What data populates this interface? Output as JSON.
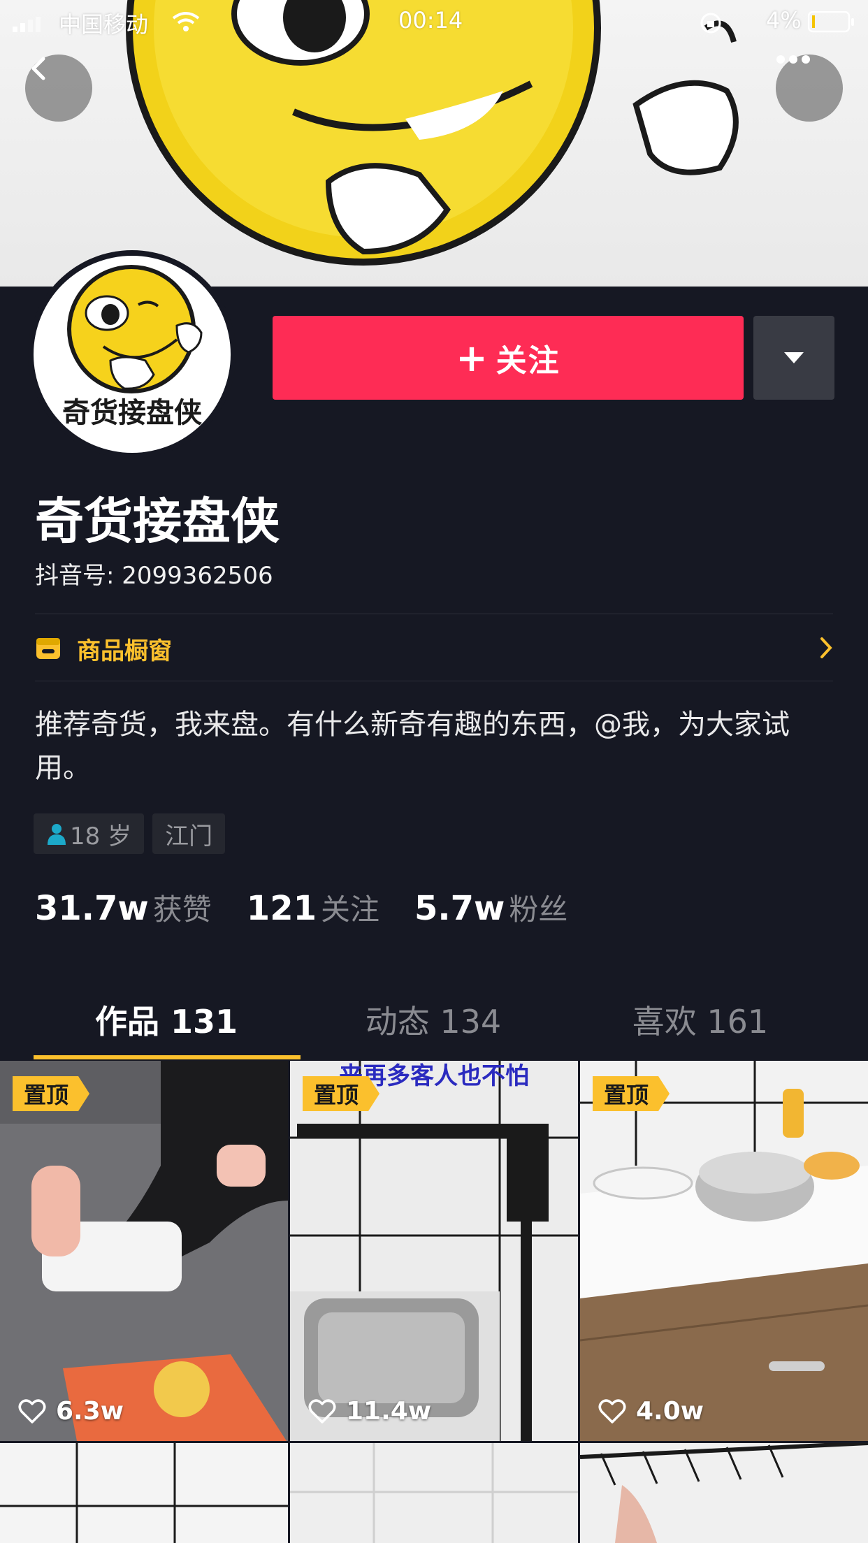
{
  "status_bar": {
    "carrier": "中国移动",
    "time": "00:14",
    "battery": "4%"
  },
  "profile": {
    "avatar_text": "奇货接盘侠",
    "name": "奇货接盘侠",
    "uid": "抖音号: 2099362506",
    "follow_label": "关注",
    "shop_label": "商品橱窗",
    "bio": "推荐奇货，我来盘。有什么新奇有趣的东西，@我，为大家试用。",
    "tags": [
      "18 岁",
      "江门"
    ],
    "stats": [
      {
        "num": "31.7w",
        "label": "获赞"
      },
      {
        "num": "121",
        "label": "关注"
      },
      {
        "num": "5.7w",
        "label": "粉丝"
      }
    ]
  },
  "tabs": [
    {
      "label": "作品 131",
      "active": true
    },
    {
      "label": "动态 134",
      "active": false
    },
    {
      "label": "喜欢 161",
      "active": false
    }
  ],
  "videos": [
    {
      "pinned": "置顶",
      "likes": "6.3w",
      "caption": ""
    },
    {
      "pinned": "置顶",
      "likes": "11.4w",
      "caption": "来再多客人也不怕"
    },
    {
      "pinned": "置顶",
      "likes": "4.0w",
      "caption": ""
    }
  ],
  "colors": {
    "background": "#161823",
    "follow": "#fe2c55",
    "accent": "#fbc02d"
  },
  "icons": [
    "back-icon",
    "more-dots-icon",
    "caret-down-icon",
    "shop-icon",
    "chevron-right-icon",
    "person-icon",
    "heart-icon"
  ]
}
